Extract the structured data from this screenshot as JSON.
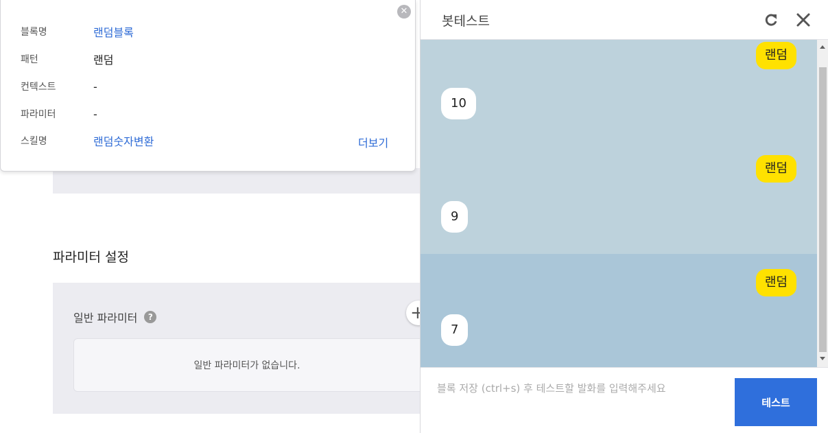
{
  "background": {
    "section_title": "파라미터 설정",
    "general_param_label": "일반 파라미터",
    "help_glyph": "?",
    "add_glyph": "+",
    "empty_text": "일반 파라미터가 없습니다."
  },
  "info_card": {
    "close_glyph": "✕",
    "rows": [
      {
        "label": "블록명",
        "value": "랜덤블록"
      },
      {
        "label": "패턴",
        "value": "랜덤"
      },
      {
        "label": "컨텍스트",
        "value": "-"
      },
      {
        "label": "파라미터",
        "value": "-"
      },
      {
        "label": "스킬명",
        "value": "랜덤숫자변환"
      }
    ],
    "more_label": "더보기"
  },
  "bot_test": {
    "title": "봇테스트",
    "messages": [
      {
        "from": "user",
        "text": "랜덤"
      },
      {
        "from": "bot",
        "text": "10"
      },
      {
        "from": "user",
        "text": "랜덤"
      },
      {
        "from": "bot",
        "text": "9"
      },
      {
        "from": "user",
        "text": "랜덤"
      },
      {
        "from": "bot",
        "text": "7"
      }
    ],
    "input_placeholder": "블록 저장 (ctrl+s) 후 테스트할 발화를 입력해주세요",
    "input_value": "",
    "test_button": "테스트"
  },
  "colors": {
    "accent": "#2f6fdc",
    "link": "#2e6bd6",
    "user_bubble": "#ffe100",
    "chat_bg": "#bdd2dc",
    "chat_highlight": "#aac6d8"
  }
}
